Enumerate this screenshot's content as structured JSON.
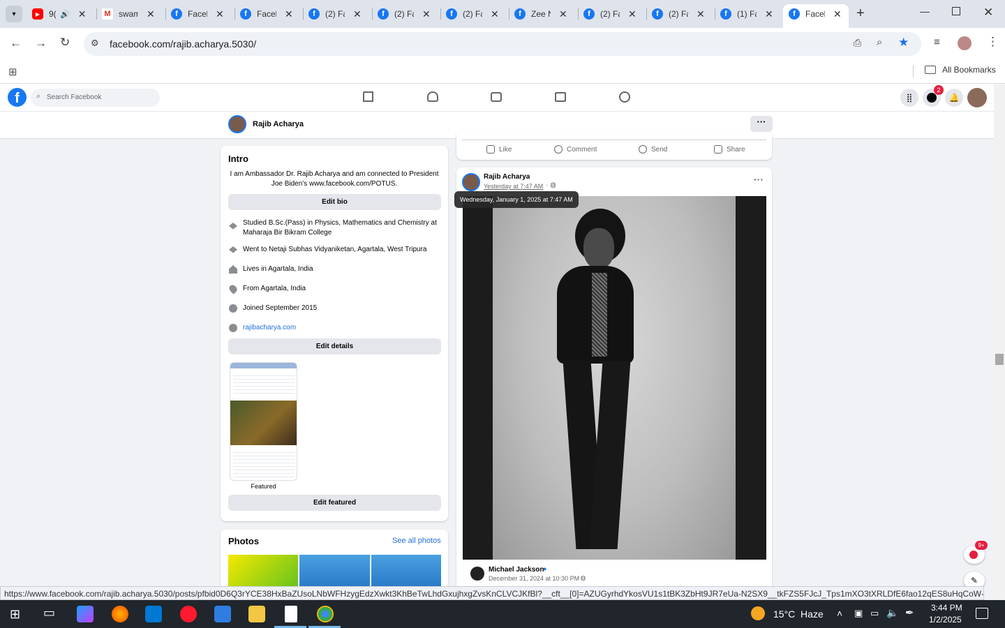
{
  "browser": {
    "tabs": [
      {
        "title": "9(",
        "fav": "youtube-icon"
      },
      {
        "title": "swam",
        "fav": "gmail-icon"
      },
      {
        "title": "Faceb",
        "fav": "facebook-icon"
      },
      {
        "title": "Faceb",
        "fav": "facebook-icon"
      },
      {
        "title": "(2) Fa",
        "fav": "facebook-icon"
      },
      {
        "title": "(2) Fa",
        "fav": "facebook-icon"
      },
      {
        "title": "(2) Fa",
        "fav": "facebook-icon"
      },
      {
        "title": "Zee N",
        "fav": "facebook-icon"
      },
      {
        "title": "(2) Fa",
        "fav": "facebook-icon"
      },
      {
        "title": "(2) Fa",
        "fav": "facebook-icon"
      },
      {
        "title": "(1) Fa",
        "fav": "facebook-icon"
      },
      {
        "title": "Faceb",
        "fav": "facebook-icon"
      }
    ],
    "url": "facebook.com/rajib.acharya.5030/",
    "all_bookmarks": "All Bookmarks",
    "status_url": "https://www.facebook.com/rajib.acharya.5030/posts/pfbid0D6Q3rYCE38HxBaZUsoLNbWFHzygEdzXwkt3KhBeTwLhdGxujhxgZvsKnCLVCJKfBl?__cft__[0]=AZUGyrhdYkosVU1s1tBK3ZbHt9JR7eUa-N2SX9__tkFZS5FJcJ_Tps1mXO3tXRLDfE6fao12qES8uHqCoW-tokOm-pC..."
  },
  "fb": {
    "search_placeholder": "Search Facebook",
    "messenger_badge": "2",
    "profile_name": "Rajib Acharya",
    "intro": {
      "title": "Intro",
      "bio": "I am Ambassador Dr. Rajib Acharya and am connected to President Joe Biden's www.facebook.com/POTUS.",
      "edit_bio": "Edit bio",
      "items": [
        {
          "icon": "graduation-cap-icon",
          "text": "Studied B.Sc.(Pass) in Physics, Mathematics and Chemistry at Maharaja Bir Bikram College"
        },
        {
          "icon": "graduation-cap-icon",
          "text": "Went to Netaji Subhas Vidyaniketan, Agartala, West Tripura"
        },
        {
          "icon": "home-icon",
          "text": "Lives in Agartala, India"
        },
        {
          "icon": "location-pin-icon",
          "text": "From Agartala, India"
        },
        {
          "icon": "clock-icon",
          "text": "Joined September 2015"
        },
        {
          "icon": "globe-icon",
          "text": "rajibacharya.com"
        }
      ],
      "edit_details": "Edit details",
      "featured_label": "Featured",
      "edit_featured": "Edit featured"
    },
    "photos": {
      "title": "Photos",
      "see_all": "See all photos"
    },
    "actions": {
      "like": "Like",
      "comment": "Comment",
      "send": "Send",
      "share": "Share"
    },
    "post": {
      "author": "Rajib Acharya",
      "time": "Yesterday at 7:47 AM",
      "tooltip": "Wednesday, January 1, 2025 at 7:47 AM",
      "shared_author": "Michael Jackson",
      "shared_time": "December 31, 2024 at 10:30 PM"
    },
    "news_badge": "9+"
  },
  "taskbar": {
    "weather": "15°C  Haze",
    "time": "3:44 PM",
    "date": "1/2/2025"
  }
}
